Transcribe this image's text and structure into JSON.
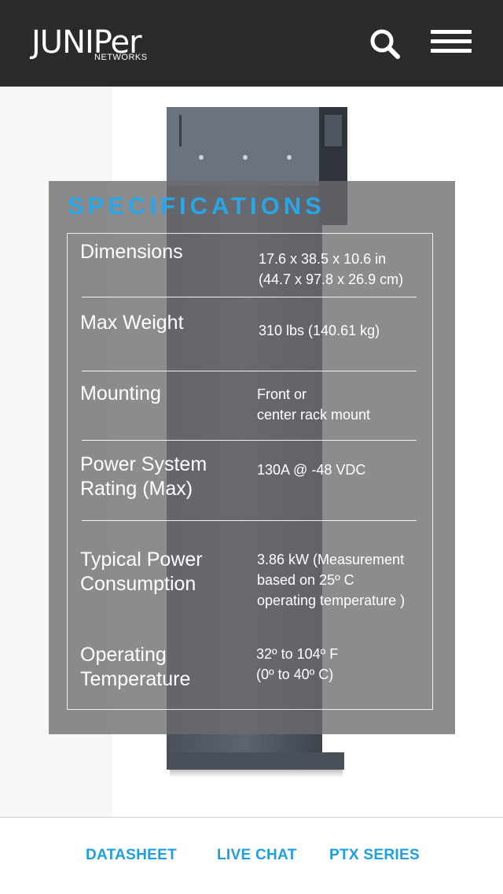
{
  "header": {
    "logo_text": "JUNIPer",
    "logo_sub": "NETWORKS",
    "search_icon": "search-icon",
    "menu_icon": "hamburger-menu-icon",
    "background": "#2b2b2b"
  },
  "specifications": {
    "title": "SPECIFICATIONS",
    "title_color": "#29a6e6",
    "rows": [
      {
        "label_lines": [
          "Dimensions"
        ],
        "value_lines": [
          "17.6 x 38.5 x 10.6 in",
          "(44.7 x 97.8 x 26.9 cm)"
        ]
      },
      {
        "label_lines": [
          "Max Weight"
        ],
        "value_lines": [
          "310 lbs (140.61 kg)"
        ]
      },
      {
        "label_lines": [
          "Mounting"
        ],
        "value_lines": [
          "Front or",
          "center rack mount"
        ]
      },
      {
        "label_lines": [
          "Power System",
          "Rating (Max)"
        ],
        "value_lines": [
          "130A @ -48 VDC"
        ]
      },
      {
        "label_lines": [
          "Typical Power",
          "Consumption"
        ],
        "value_lines": [
          "3.86 kW (Measurement",
          "based on 25º C",
          "operating temperature )"
        ]
      },
      {
        "label_lines": [
          "Operating",
          "Temperature"
        ],
        "value_lines": [
          "32º to 104º F",
          "(0º to 40º C)"
        ]
      }
    ]
  },
  "footer": {
    "links": [
      "DATASHEET",
      "LIVE CHAT",
      "PTX SERIES"
    ],
    "link_color": "#1e9fe0"
  }
}
